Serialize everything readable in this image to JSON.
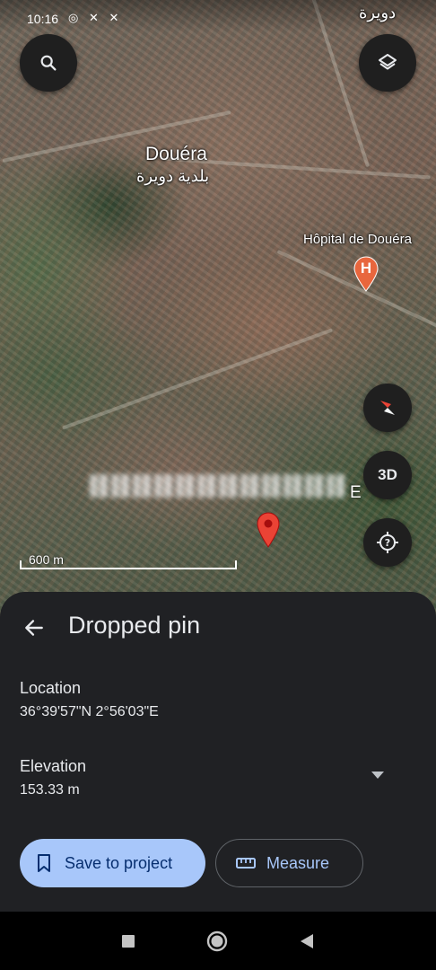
{
  "status_bar": {
    "time": "10:16",
    "icons": "◎ ✕ ✕"
  },
  "map": {
    "arabic_top_label": "دويرة",
    "city_label": "Douéra",
    "city_label_arabic": "بلدية دويرة",
    "hospital_label": "Hôpital de Douéra",
    "hospital_pin_letter": "H",
    "coordinates_overlay_suffix": "E",
    "scale_label": "600 m",
    "buttons": {
      "three_d_label": "3D"
    }
  },
  "sheet": {
    "title": "Dropped pin",
    "location_label": "Location",
    "location_value": "36°39'57\"N 2°56'03\"E",
    "elevation_label": "Elevation",
    "elevation_value": "153.33 m",
    "save_label": "Save to project",
    "measure_label": "Measure"
  },
  "colors": {
    "sheet_bg": "#202124",
    "primary_button": "#a8c7fa",
    "primary_button_text": "#062e6f",
    "pin_red": "#ea4335"
  }
}
